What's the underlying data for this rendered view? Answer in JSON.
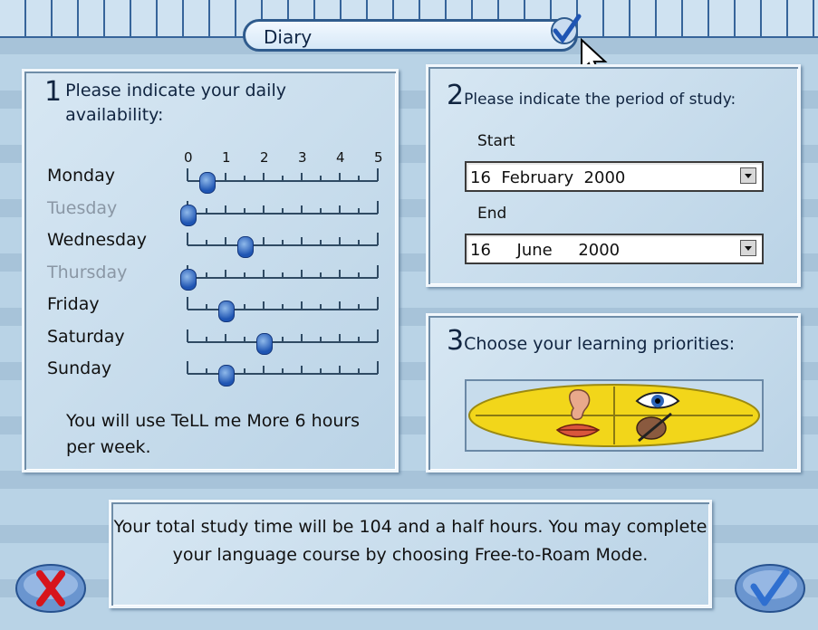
{
  "window": {
    "title": "Diary"
  },
  "step1": {
    "number": "1",
    "text": "Please indicate your daily availability:",
    "scale": [
      "0",
      "1",
      "2",
      "3",
      "4",
      "5"
    ],
    "days": [
      {
        "label": "Monday",
        "hours": 0.5,
        "dim": false
      },
      {
        "label": "Tuesday",
        "hours": 0,
        "dim": true
      },
      {
        "label": "Wednesday",
        "hours": 1.5,
        "dim": false
      },
      {
        "label": "Thursday",
        "hours": 0,
        "dim": true
      },
      {
        "label": "Friday",
        "hours": 1,
        "dim": false
      },
      {
        "label": "Saturday",
        "hours": 2,
        "dim": false
      },
      {
        "label": "Sunday",
        "hours": 1,
        "dim": false
      }
    ],
    "summary": "You will use TeLL me More 6 hours per week."
  },
  "step2": {
    "number": "2",
    "text": "Please indicate the period of study:",
    "start_label": "Start",
    "start_value": "16  February  2000",
    "end_label": "End",
    "end_value": "16     June     2000"
  },
  "step3": {
    "number": "3",
    "text": "Choose your learning priorities:",
    "icons": [
      "ear-icon",
      "eye-icon",
      "mouth-icon",
      "hand-writing-icon"
    ]
  },
  "footer": {
    "message": "Your total study time will be 104 and a half hours. You may complete your language course by choosing Free-to-Roam Mode."
  },
  "colors": {
    "panel": "#c8dded",
    "knob": "#1f55b3",
    "cancel": "#d7141b",
    "ok": "#2f6fd0"
  }
}
